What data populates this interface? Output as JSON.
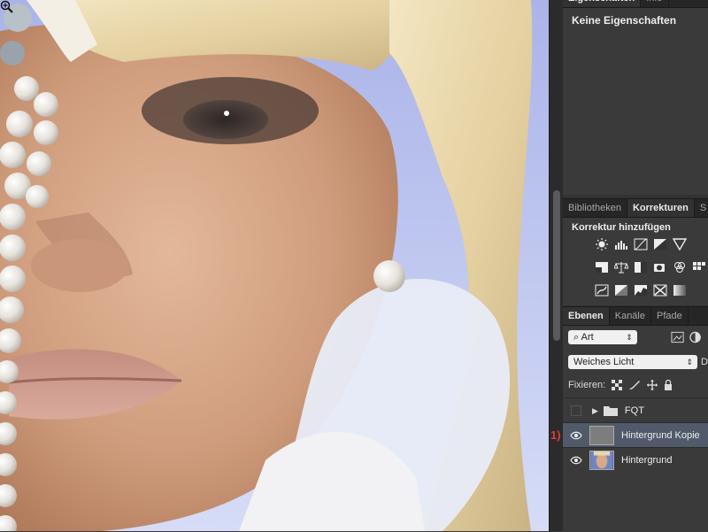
{
  "properties": {
    "tabs": [
      "Eigenschaften",
      "Info"
    ],
    "title": "Keine Eigenschaften"
  },
  "adjustments": {
    "tabs": [
      "Bibliotheken",
      "Korrekturen",
      "S"
    ],
    "active_tab": "Korrekturen",
    "heading": "Korrektur hinzufügen",
    "icons": [
      [
        "brightness-icon",
        "levels-icon",
        "curves-icon",
        "exposure-icon",
        "vibrance-icon"
      ],
      [
        "hue-icon",
        "balance-icon",
        "bw-icon",
        "photo-filter-icon",
        "channel-mixer-icon",
        "lookup-icon"
      ],
      [
        "invert-icon",
        "posterize-icon",
        "threshold-icon",
        "selective-color-icon",
        "gradient-map-icon"
      ]
    ]
  },
  "layers": {
    "tabs": [
      "Ebenen",
      "Kanäle",
      "Pfade"
    ],
    "active_tab": "Ebenen",
    "filter_label": "Art",
    "blend_mode": "Weiches Licht",
    "opacity_initial": "D",
    "lock_label": "Fixieren:",
    "items": [
      {
        "name": "FQT",
        "type": "group",
        "visible": false,
        "selected": false
      },
      {
        "name": "Hintergrund Kopie",
        "type": "layer",
        "visible": true,
        "selected": true,
        "marker": "1)"
      },
      {
        "name": "Hintergrund",
        "type": "layer",
        "visible": true,
        "selected": false
      }
    ]
  },
  "colors": {
    "panel_bg": "#3a3a3a",
    "selected_row": "#505a6a",
    "marker": "#e23b3b"
  }
}
